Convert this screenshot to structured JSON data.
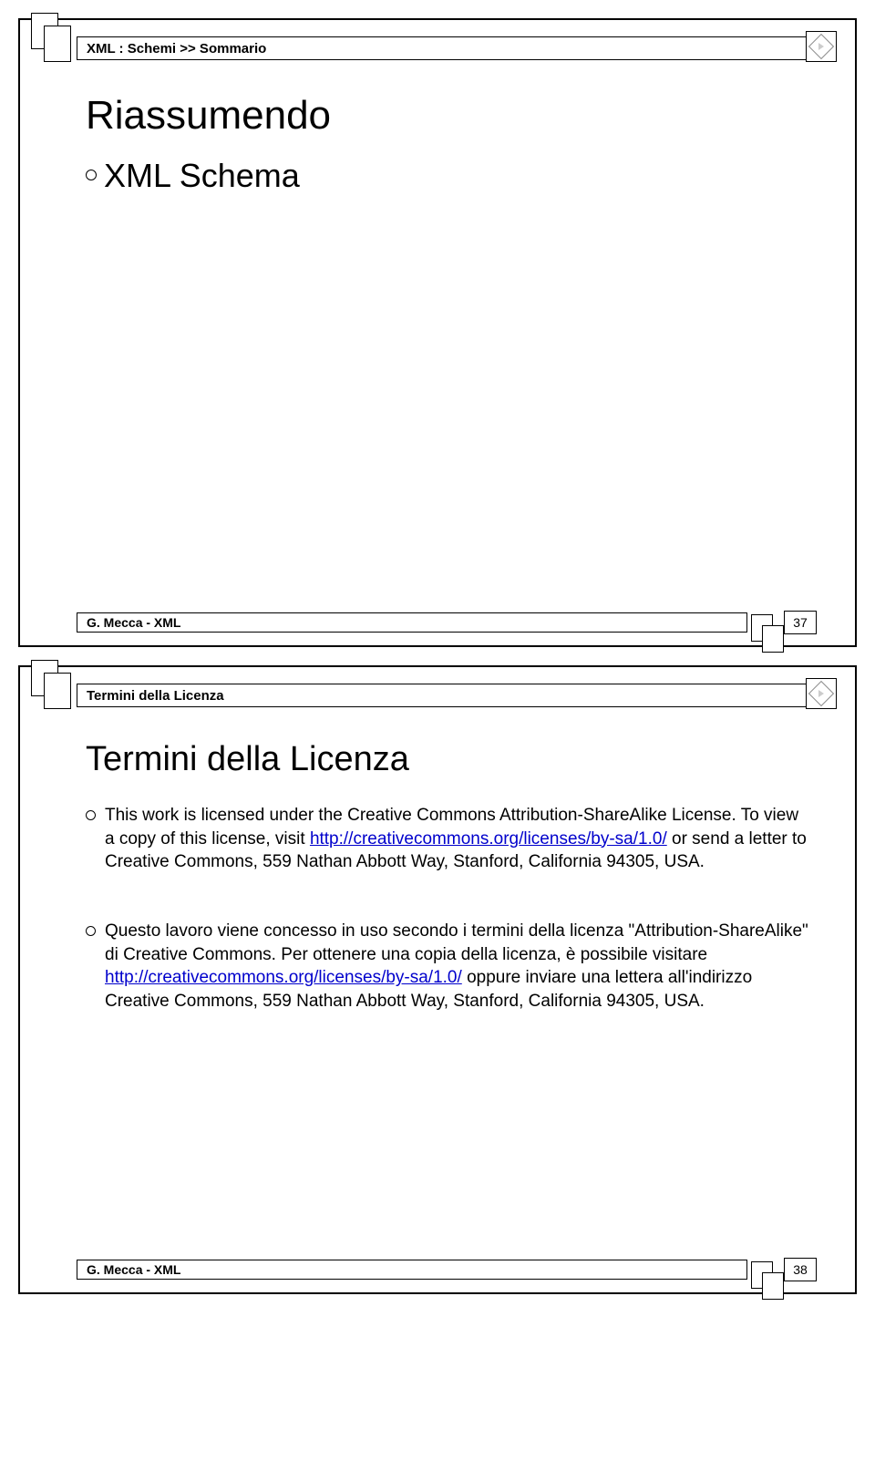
{
  "slide1": {
    "breadcrumb": "XML : Schemi >> Sommario",
    "title": "Riassumendo",
    "bullet": "XML Schema",
    "footer": "G. Mecca - XML",
    "page": "37"
  },
  "slide2": {
    "breadcrumb": "Termini della Licenza",
    "title": "Termini della Licenza",
    "para1_a": "This work is licensed under the Creative Commons Attribution-ShareAlike License. To view a copy of this license, visit ",
    "para1_link": "http://creativecommons.org/licenses/by-sa/1.0/",
    "para1_b": " or send a letter to Creative Commons, 559 Nathan Abbott Way, Stanford, California 94305, USA.",
    "para2_a": "Questo lavoro viene concesso in uso secondo i termini della licenza \"Attribution-ShareAlike\" di Creative Commons. Per ottenere una copia della licenza, è possibile visitare ",
    "para2_link": "http://creativecommons.org/licenses/by-sa/1.0/",
    "para2_b": " oppure inviare una lettera all'indirizzo Creative Commons, 559 Nathan Abbott Way, Stanford, California 94305, USA.",
    "footer": "G. Mecca - XML",
    "page": "38"
  }
}
